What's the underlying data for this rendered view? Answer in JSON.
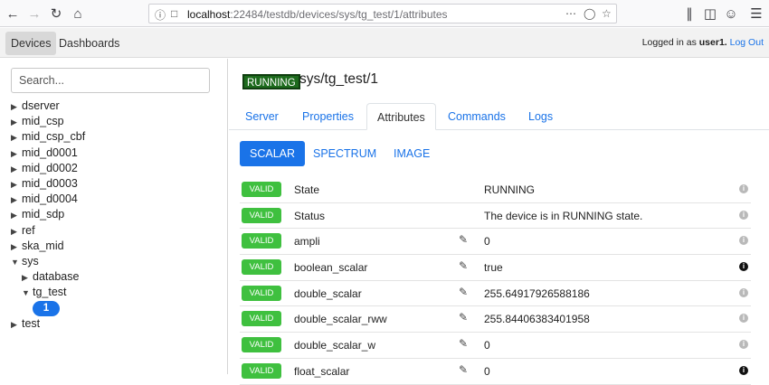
{
  "browser": {
    "url_host": "localhost",
    "url_path": ":22484/testdb/devices/sys/tg_test/1/attributes"
  },
  "header": {
    "tabs": [
      "Devices",
      "Dashboards"
    ],
    "login_prefix": "Logged in as",
    "user": "user1.",
    "logout": "Log Out"
  },
  "sidebar": {
    "search_placeholder": "Search...",
    "tree": [
      {
        "label": "dserver",
        "expanded": false,
        "level": 0
      },
      {
        "label": "mid_csp",
        "expanded": false,
        "level": 0
      },
      {
        "label": "mid_csp_cbf",
        "expanded": false,
        "level": 0
      },
      {
        "label": "mid_d0001",
        "expanded": false,
        "level": 0
      },
      {
        "label": "mid_d0002",
        "expanded": false,
        "level": 0
      },
      {
        "label": "mid_d0003",
        "expanded": false,
        "level": 0
      },
      {
        "label": "mid_d0004",
        "expanded": false,
        "level": 0
      },
      {
        "label": "mid_sdp",
        "expanded": false,
        "level": 0
      },
      {
        "label": "ref",
        "expanded": false,
        "level": 0
      },
      {
        "label": "ska_mid",
        "expanded": false,
        "level": 0
      },
      {
        "label": "sys",
        "expanded": true,
        "level": 0
      },
      {
        "label": "database",
        "expanded": false,
        "level": 1
      },
      {
        "label": "tg_test",
        "expanded": true,
        "level": 1
      },
      {
        "label": "1",
        "selected": true,
        "level": 2
      },
      {
        "label": "test",
        "expanded": false,
        "level": 0
      }
    ]
  },
  "device": {
    "state": "RUNNING",
    "name": "sys/tg_test/1"
  },
  "tabs": [
    "Server",
    "Properties",
    "Attributes",
    "Commands",
    "Logs"
  ],
  "active_tab": "Attributes",
  "subtabs": [
    "SCALAR",
    "SPECTRUM",
    "IMAGE"
  ],
  "active_subtab": "SCALAR",
  "attributes": [
    {
      "quality": "VALID",
      "name": "State",
      "writable": false,
      "value": "RUNNING",
      "info_dark": false
    },
    {
      "quality": "VALID",
      "name": "Status",
      "writable": false,
      "value": "The device is in RUNNING state.",
      "info_dark": false
    },
    {
      "quality": "VALID",
      "name": "ampli",
      "writable": true,
      "value": "0",
      "info_dark": false
    },
    {
      "quality": "VALID",
      "name": "boolean_scalar",
      "writable": true,
      "value": "true",
      "info_dark": true
    },
    {
      "quality": "VALID",
      "name": "double_scalar",
      "writable": true,
      "value": "255.64917926588186",
      "info_dark": false
    },
    {
      "quality": "VALID",
      "name": "double_scalar_rww",
      "writable": true,
      "value": "255.84406383401958",
      "info_dark": false
    },
    {
      "quality": "VALID",
      "name": "double_scalar_w",
      "writable": true,
      "value": "0",
      "info_dark": false
    },
    {
      "quality": "VALID",
      "name": "float_scalar",
      "writable": true,
      "value": "0",
      "info_dark": true
    }
  ],
  "colors": {
    "accent": "#1a73e8",
    "valid": "#3fc03f",
    "running": "#1d6b1d"
  }
}
